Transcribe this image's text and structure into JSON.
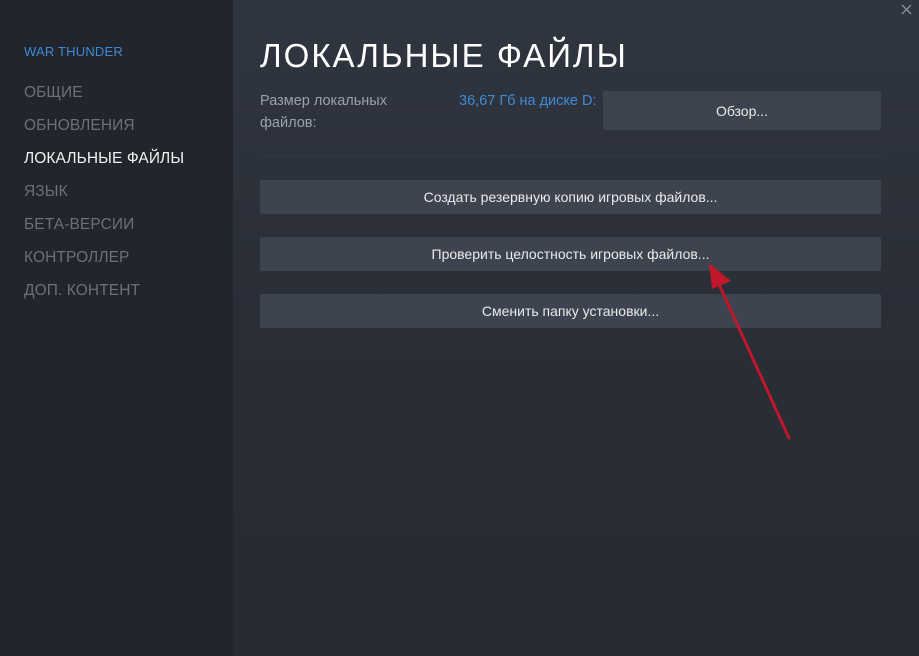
{
  "sidebar": {
    "game_title": "WAR THUNDER",
    "items": [
      {
        "label": "ОБЩИЕ",
        "active": false
      },
      {
        "label": "ОБНОВЛЕНИЯ",
        "active": false
      },
      {
        "label": "ЛОКАЛЬНЫЕ ФАЙЛЫ",
        "active": true
      },
      {
        "label": "ЯЗЫК",
        "active": false
      },
      {
        "label": "БЕТА-ВЕРСИИ",
        "active": false
      },
      {
        "label": "КОНТРОЛЛЕР",
        "active": false
      },
      {
        "label": "ДОП. КОНТЕНТ",
        "active": false
      }
    ]
  },
  "main": {
    "title": "ЛОКАЛЬНЫЕ ФАЙЛЫ",
    "size_label": "Размер локальных файлов:",
    "size_value": "36,67 Гб на диске D:",
    "browse_button": "Обзор...",
    "backup_button": "Создать резервную копию игровых файлов...",
    "verify_button": "Проверить целостность игровых файлов...",
    "move_button": "Сменить папку установки..."
  },
  "colors": {
    "accent_blue": "#3d8ad9",
    "annotation_arrow": "#c0172a"
  },
  "icons": {
    "close": "close-icon"
  }
}
